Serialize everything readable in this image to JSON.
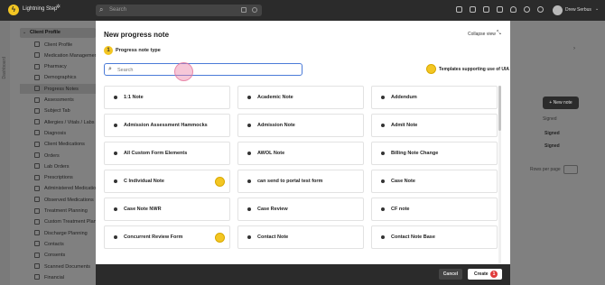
{
  "app": {
    "brand": "Lightning Step",
    "search_placeholder": "Search",
    "user_name": "Drew Serbus"
  },
  "rail": {
    "label": "Dashboard"
  },
  "sidebar": {
    "header": "Client Profile",
    "items": [
      {
        "label": "Client Profile",
        "icon": "user-icon"
      },
      {
        "label": "Medication Management",
        "icon": "pill-icon"
      },
      {
        "label": "Pharmacy",
        "icon": "pharmacy-icon"
      },
      {
        "label": "Demographics",
        "icon": "demographics-icon"
      },
      {
        "label": "Progress Notes",
        "icon": "notes-icon",
        "active": true
      },
      {
        "label": "Assessments",
        "icon": "assessment-icon"
      },
      {
        "label": "Subject Tab",
        "icon": "tab-icon"
      },
      {
        "label": "Allergies / Vitals / Labs",
        "icon": "vitals-icon"
      },
      {
        "label": "Diagnosis",
        "icon": "diagnosis-icon"
      },
      {
        "label": "Client Medications",
        "icon": "medication-icon"
      },
      {
        "label": "Orders",
        "icon": "orders-icon"
      },
      {
        "label": "Lab Orders",
        "icon": "lab-icon"
      },
      {
        "label": "Prescriptions",
        "icon": "prescription-icon"
      },
      {
        "label": "Administered Medications",
        "icon": "administered-icon"
      },
      {
        "label": "Observed Medications",
        "icon": "observed-icon"
      },
      {
        "label": "Treatment Planning",
        "icon": "plan-icon"
      },
      {
        "label": "Custom Treatment Plans",
        "icon": "custom-plan-icon"
      },
      {
        "label": "Discharge Planning",
        "icon": "discharge-icon"
      },
      {
        "label": "Contacts",
        "icon": "contacts-icon"
      },
      {
        "label": "Consents",
        "icon": "consent-icon"
      },
      {
        "label": "Scanned Documents",
        "icon": "documents-icon"
      },
      {
        "label": "Financial",
        "icon": "financial-icon"
      }
    ]
  },
  "background": {
    "new_note": "New note",
    "signed_header": "Signed",
    "signed_1": "Signed",
    "signed_2": "Signed",
    "rows_per_page": "Rows per page"
  },
  "modal": {
    "title": "New progress note",
    "collapse": "Collapse view",
    "step_number": "1",
    "step_label": "Progress note type",
    "search_placeholder": "Search",
    "uia_label": "Templates supporting use of UIA",
    "cards": [
      {
        "label": "1:1 Note",
        "uia": false
      },
      {
        "label": "Academic Note",
        "uia": false
      },
      {
        "label": "Addendum",
        "uia": false
      },
      {
        "label": "Admission Assessment Hammocks",
        "uia": false
      },
      {
        "label": "Admission Note",
        "uia": false
      },
      {
        "label": "Admit Note",
        "uia": false
      },
      {
        "label": "All Custom Form Elements",
        "uia": false
      },
      {
        "label": "AWOL Note",
        "uia": false
      },
      {
        "label": "Billing Note Change",
        "uia": false
      },
      {
        "label": "C Individual Note",
        "uia": true
      },
      {
        "label": "can send to portal test form",
        "uia": false
      },
      {
        "label": "Case Note",
        "uia": false
      },
      {
        "label": "Case Note NWR",
        "uia": false
      },
      {
        "label": "Case Review",
        "uia": false
      },
      {
        "label": "CF note",
        "uia": false
      },
      {
        "label": "Concurrent Review Form",
        "uia": true
      },
      {
        "label": "Contact Note",
        "uia": false
      },
      {
        "label": "Contact Note Base",
        "uia": false
      }
    ],
    "cancel": "Cancel",
    "create": "Create",
    "create_badge": "1"
  }
}
